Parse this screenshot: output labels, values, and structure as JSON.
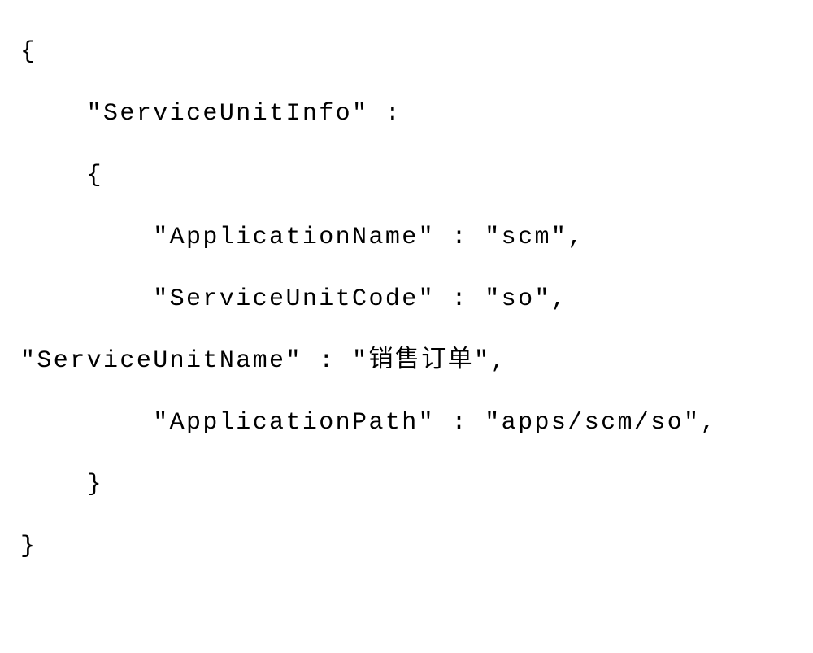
{
  "code": {
    "line1": "{",
    "line2": "    \"ServiceUnitInfo\" :",
    "line3": "    {",
    "line4": "        \"ApplicationName\" : \"scm\",",
    "line5": "        \"ServiceUnitCode\" : \"so\",",
    "line6": "\"ServiceUnitName\" : \"销售订单\",",
    "line7": "        \"ApplicationPath\" : \"apps/scm/so\",",
    "line8": "    }",
    "line9": "}"
  }
}
